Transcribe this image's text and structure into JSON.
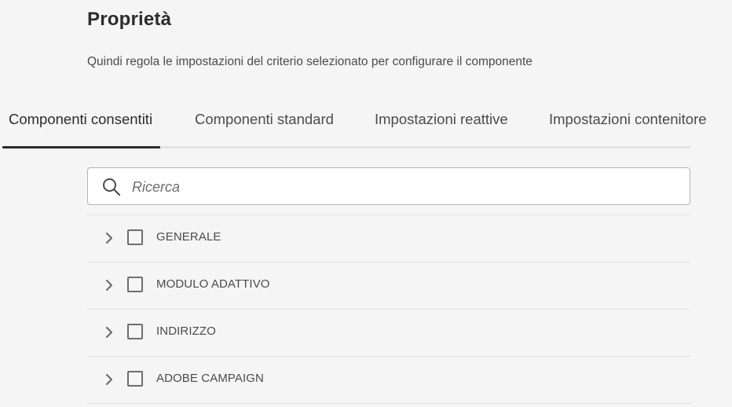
{
  "page": {
    "title": "Proprietà",
    "subtitle": "Quindi regola le impostazioni del criterio selezionato per configurare il componente"
  },
  "tabs": [
    {
      "label": "Componenti consentiti",
      "active": true
    },
    {
      "label": "Componenti standard",
      "active": false
    },
    {
      "label": "Impostazioni reattive",
      "active": false
    },
    {
      "label": "Impostazioni contenitore",
      "active": false
    }
  ],
  "search": {
    "placeholder": "Ricerca",
    "value": "",
    "icon": "search-icon"
  },
  "tree": {
    "items": [
      {
        "label": "GENERALE",
        "checked": false,
        "expanded": false
      },
      {
        "label": "MODULO ADATTIVO",
        "checked": false,
        "expanded": false
      },
      {
        "label": "INDIRIZZO",
        "checked": false,
        "expanded": false
      },
      {
        "label": "ADOBE CAMPAIGN",
        "checked": false,
        "expanded": false
      }
    ]
  },
  "colors": {
    "background": "#f5f5f5",
    "text": "#2c2c2c",
    "secondary_text": "#4b4b4b",
    "active_tab_indicator": "#2c2c2c",
    "divider": "#e1e1e1"
  }
}
